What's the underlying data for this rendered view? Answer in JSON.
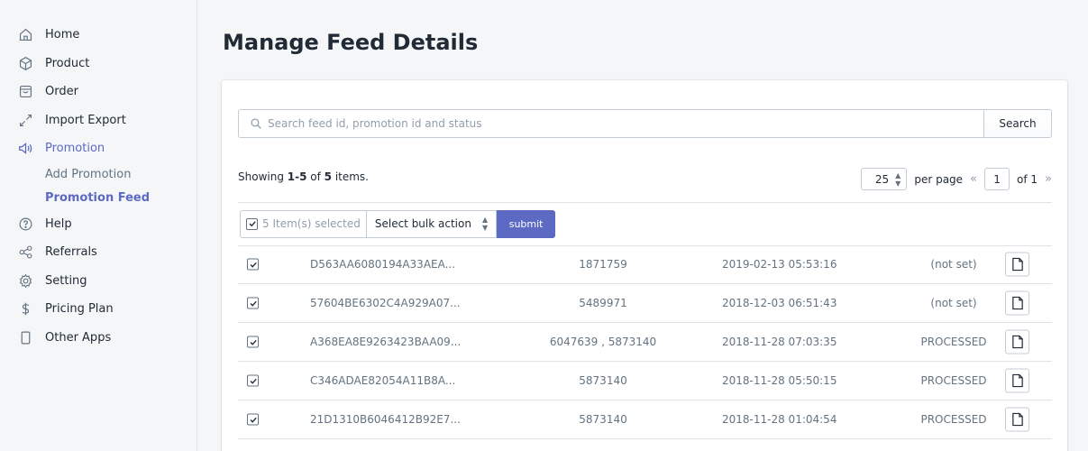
{
  "sidebar": {
    "items": [
      {
        "label": "Home",
        "icon": "home-icon"
      },
      {
        "label": "Product",
        "icon": "product-icon"
      },
      {
        "label": "Order",
        "icon": "order-icon"
      },
      {
        "label": "Import Export",
        "icon": "import-export-icon"
      },
      {
        "label": "Promotion",
        "icon": "megaphone-icon",
        "active": true
      },
      {
        "label": "Help",
        "icon": "help-icon"
      },
      {
        "label": "Referrals",
        "icon": "share-icon"
      },
      {
        "label": "Setting",
        "icon": "gear-icon"
      },
      {
        "label": "Pricing Plan",
        "icon": "dollar-icon"
      },
      {
        "label": "Other Apps",
        "icon": "mobile-icon"
      }
    ],
    "promotion_sub": [
      {
        "label": "Add Promotion"
      },
      {
        "label": "Promotion Feed",
        "active": true
      }
    ]
  },
  "page": {
    "title": "Manage Feed Details"
  },
  "search": {
    "placeholder": "Search feed id, promotion id and status",
    "value": "",
    "button": "Search"
  },
  "summary": {
    "prefix": "Showing ",
    "range": "1-5",
    "mid": " of ",
    "total": "5",
    "suffix": " items."
  },
  "pagination": {
    "per_page_value": "25",
    "per_page_label": "per page",
    "current_page": "1",
    "of_label": "of 1"
  },
  "bulk": {
    "selected_label": "5 Item(s) selected",
    "action_placeholder": "Select bulk action",
    "submit": "submit"
  },
  "rows": [
    {
      "feed_id": "D563AA6080194A33AEA...",
      "promotion_id": "1871759",
      "date": "2019-02-13 05:53:16",
      "status": "(not set)",
      "checked": true
    },
    {
      "feed_id": "57604BE6302C4A929A07...",
      "promotion_id": "5489971",
      "date": "2018-12-03 06:51:43",
      "status": "(not set)",
      "checked": true
    },
    {
      "feed_id": "A368EA8E9263423BAA09...",
      "promotion_id": "6047639 , 5873140",
      "date": "2018-11-28 07:03:35",
      "status": "PROCESSED",
      "checked": true
    },
    {
      "feed_id": "C346ADAE82054A11B8A...",
      "promotion_id": "5873140",
      "date": "2018-11-28 05:50:15",
      "status": "PROCESSED",
      "checked": true
    },
    {
      "feed_id": "21D1310B6046412B92E7...",
      "promotion_id": "5873140",
      "date": "2018-11-28 01:04:54",
      "status": "PROCESSED",
      "checked": true
    }
  ],
  "colors": {
    "accent": "#5c6ac4",
    "text": "#212b36",
    "muted": "#637381",
    "border": "#c4cdd5",
    "background": "#f4f6f8"
  }
}
